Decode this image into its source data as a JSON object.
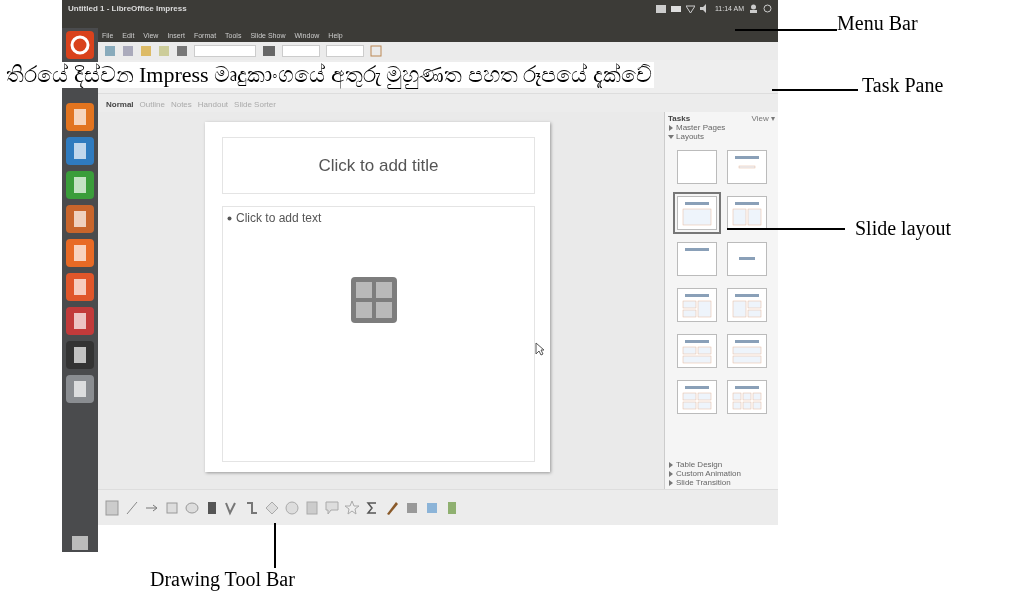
{
  "caption": "තිරයේ දිස්වන Impress මෘදුකාංගයේ අතුරු මුහුණත පහත රූපයේ දැක්වේ",
  "window": {
    "title": "Untitled 1 - LibreOffice Impress",
    "clock": "11:14 AM"
  },
  "menu": [
    "File",
    "Edit",
    "View",
    "Insert",
    "Format",
    "Tools",
    "Slide Show",
    "Window",
    "Help"
  ],
  "view_tabs": [
    {
      "label": "Normal",
      "selected": true
    },
    {
      "label": "Outline",
      "selected": false
    },
    {
      "label": "Notes",
      "selected": false
    },
    {
      "label": "Handout",
      "selected": false
    },
    {
      "label": "Slide Sorter",
      "selected": false
    }
  ],
  "slide": {
    "title_placeholder": "Click to add title",
    "text_placeholder": "Click to add text"
  },
  "task_pane": {
    "title": "Tasks",
    "view_menu": "View ▾",
    "sections_top": [
      {
        "label": "Master Pages",
        "expanded": false
      },
      {
        "label": "Layouts",
        "expanded": true
      }
    ],
    "layouts": [
      {
        "kind": "blank",
        "selected": false
      },
      {
        "kind": "title-subtitle",
        "selected": false
      },
      {
        "kind": "title-content",
        "selected": true
      },
      {
        "kind": "title-2content",
        "selected": false
      },
      {
        "kind": "title-only",
        "selected": false
      },
      {
        "kind": "centered",
        "selected": false
      },
      {
        "kind": "title-2content-content",
        "selected": false
      },
      {
        "kind": "title-content-2content",
        "selected": false
      },
      {
        "kind": "title-2content-over",
        "selected": false
      },
      {
        "kind": "title-content-over",
        "selected": false
      },
      {
        "kind": "title-4content",
        "selected": false
      },
      {
        "kind": "title-6content",
        "selected": false
      }
    ],
    "sections_bottom": [
      {
        "label": "Table Design",
        "expanded": false
      },
      {
        "label": "Custom Animation",
        "expanded": false
      },
      {
        "label": "Slide Transition",
        "expanded": false
      }
    ]
  },
  "annotations": [
    {
      "kind": "menu-bar",
      "label": "Menu Bar"
    },
    {
      "kind": "task-pane",
      "label": "Task Pane"
    },
    {
      "kind": "slide-layout",
      "label": "Slide layout"
    },
    {
      "kind": "drawing-toolbar",
      "label": "Drawing Tool Bar"
    }
  ]
}
